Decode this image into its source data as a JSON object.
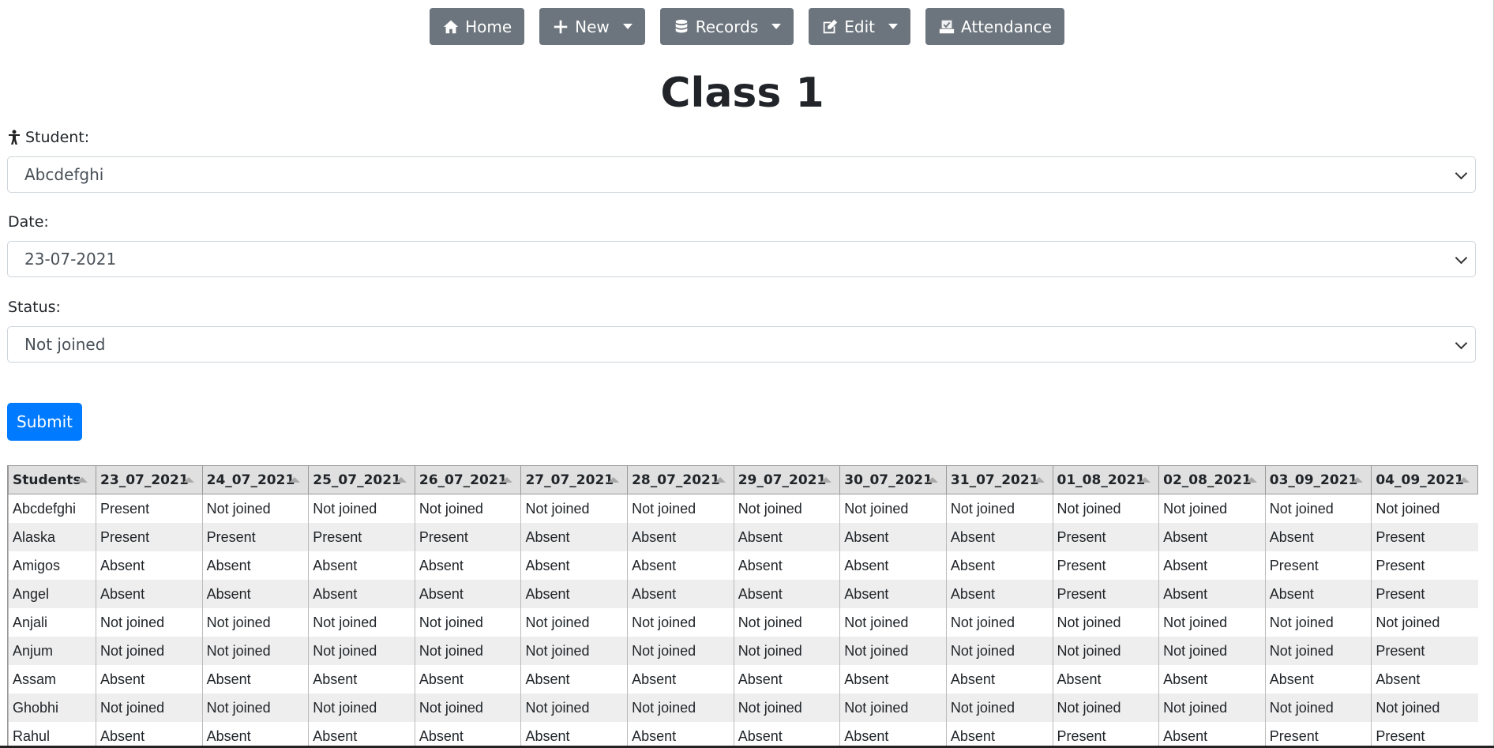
{
  "nav": [
    {
      "label": "Home",
      "icon": "home-icon",
      "dropdown": false
    },
    {
      "label": "New",
      "icon": "plus-icon",
      "dropdown": true
    },
    {
      "label": "Records",
      "icon": "database-icon",
      "dropdown": true
    },
    {
      "label": "Edit",
      "icon": "edit-icon",
      "dropdown": true
    },
    {
      "label": "Attendance",
      "icon": "attendance-icon",
      "dropdown": false
    }
  ],
  "page": {
    "title": "Class 1"
  },
  "form": {
    "student_label": "Student:",
    "student_value": "Abcdefghi",
    "date_label": "Date:",
    "date_value": "23-07-2021",
    "status_label": "Status:",
    "status_value": "Not joined",
    "submit_label": "Submit"
  },
  "table": {
    "headers": [
      "Students",
      "23_07_2021",
      "24_07_2021",
      "25_07_2021",
      "26_07_2021",
      "27_07_2021",
      "28_07_2021",
      "29_07_2021",
      "30_07_2021",
      "31_07_2021",
      "01_08_2021",
      "02_08_2021",
      "03_09_2021",
      "04_09_2021"
    ],
    "rows": [
      [
        "Abcdefghi",
        "Present",
        "Not joined",
        "Not joined",
        "Not joined",
        "Not joined",
        "Not joined",
        "Not joined",
        "Not joined",
        "Not joined",
        "Not joined",
        "Not joined",
        "Not joined",
        "Not joined"
      ],
      [
        "Alaska",
        "Present",
        "Present",
        "Present",
        "Present",
        "Absent",
        "Absent",
        "Absent",
        "Absent",
        "Absent",
        "Present",
        "Absent",
        "Absent",
        "Present"
      ],
      [
        "Amigos",
        "Absent",
        "Absent",
        "Absent",
        "Absent",
        "Absent",
        "Absent",
        "Absent",
        "Absent",
        "Absent",
        "Present",
        "Absent",
        "Present",
        "Present"
      ],
      [
        "Angel",
        "Absent",
        "Absent",
        "Absent",
        "Absent",
        "Absent",
        "Absent",
        "Absent",
        "Absent",
        "Absent",
        "Present",
        "Absent",
        "Absent",
        "Present"
      ],
      [
        "Anjali",
        "Not joined",
        "Not joined",
        "Not joined",
        "Not joined",
        "Not joined",
        "Not joined",
        "Not joined",
        "Not joined",
        "Not joined",
        "Not joined",
        "Not joined",
        "Not joined",
        "Not joined"
      ],
      [
        "Anjum",
        "Not joined",
        "Not joined",
        "Not joined",
        "Not joined",
        "Not joined",
        "Not joined",
        "Not joined",
        "Not joined",
        "Not joined",
        "Not joined",
        "Not joined",
        "Not joined",
        "Present"
      ],
      [
        "Assam",
        "Absent",
        "Absent",
        "Absent",
        "Absent",
        "Absent",
        "Absent",
        "Absent",
        "Absent",
        "Absent",
        "Absent",
        "Absent",
        "Absent",
        "Absent"
      ],
      [
        "Ghobhi",
        "Not joined",
        "Not joined",
        "Not joined",
        "Not joined",
        "Not joined",
        "Not joined",
        "Not joined",
        "Not joined",
        "Not joined",
        "Not joined",
        "Not joined",
        "Not joined",
        "Not joined"
      ],
      [
        "Rahul",
        "Absent",
        "Absent",
        "Absent",
        "Absent",
        "Absent",
        "Absent",
        "Absent",
        "Absent",
        "Absent",
        "Present",
        "Absent",
        "Present",
        "Present"
      ]
    ]
  },
  "colors": {
    "nav_button": "#6c757d",
    "submit": "#007bff"
  }
}
